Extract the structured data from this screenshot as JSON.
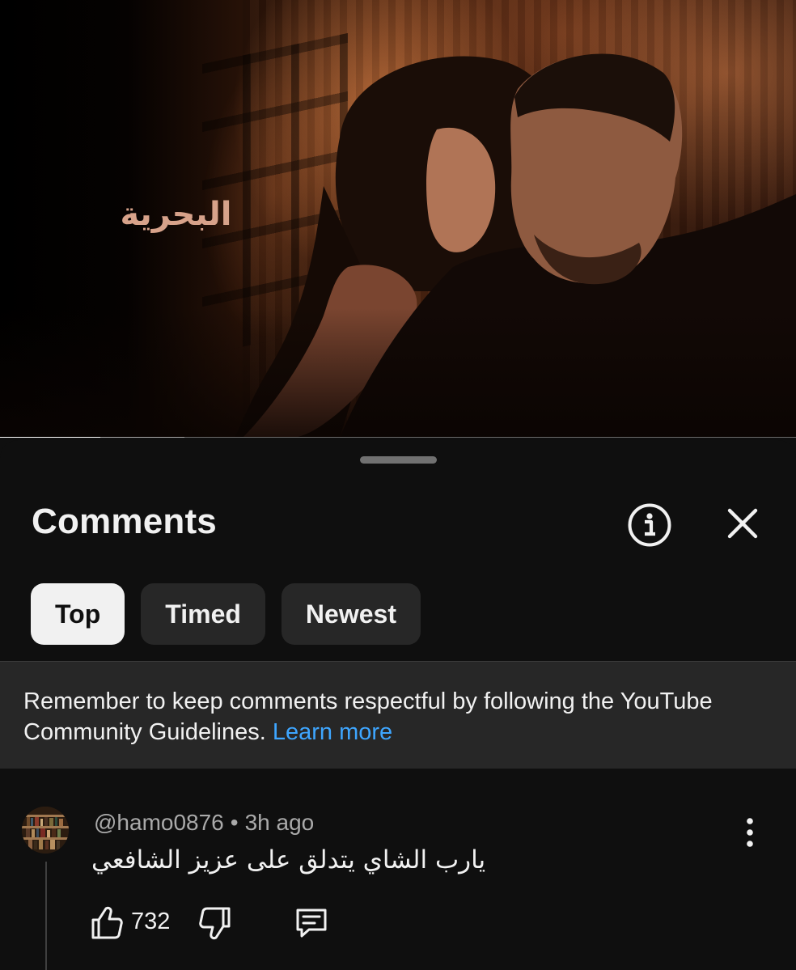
{
  "video": {
    "title_art": "البحرية",
    "progress_played": 0.126,
    "progress_buffered": 0.232
  },
  "comments_panel": {
    "title": "Comments",
    "info_icon": "info-circle-icon",
    "close_icon": "close-icon",
    "sort_chips": [
      {
        "label": "Top",
        "active": true
      },
      {
        "label": "Timed",
        "active": false
      },
      {
        "label": "Newest",
        "active": false
      }
    ],
    "guidelines": {
      "text": "Remember to keep comments respectful by following the YouTube Community Guidelines.",
      "link": "Learn more"
    }
  },
  "comment": {
    "author": "@hamo0876",
    "separator": "•",
    "time": "3h ago",
    "text": "يارب الشاي يتدلق على عزيز الشافعي",
    "likes": "732",
    "icons": [
      "thumbs-up-icon",
      "thumbs-down-icon",
      "reply-icon",
      "more-vert-icon"
    ]
  },
  "colors": {
    "background": "#0f0f0f",
    "chip_bg": "#272727",
    "chip_active_bg": "#f1f1f1",
    "link": "#3ea6ff",
    "secondary_text": "#aaaaaa"
  }
}
